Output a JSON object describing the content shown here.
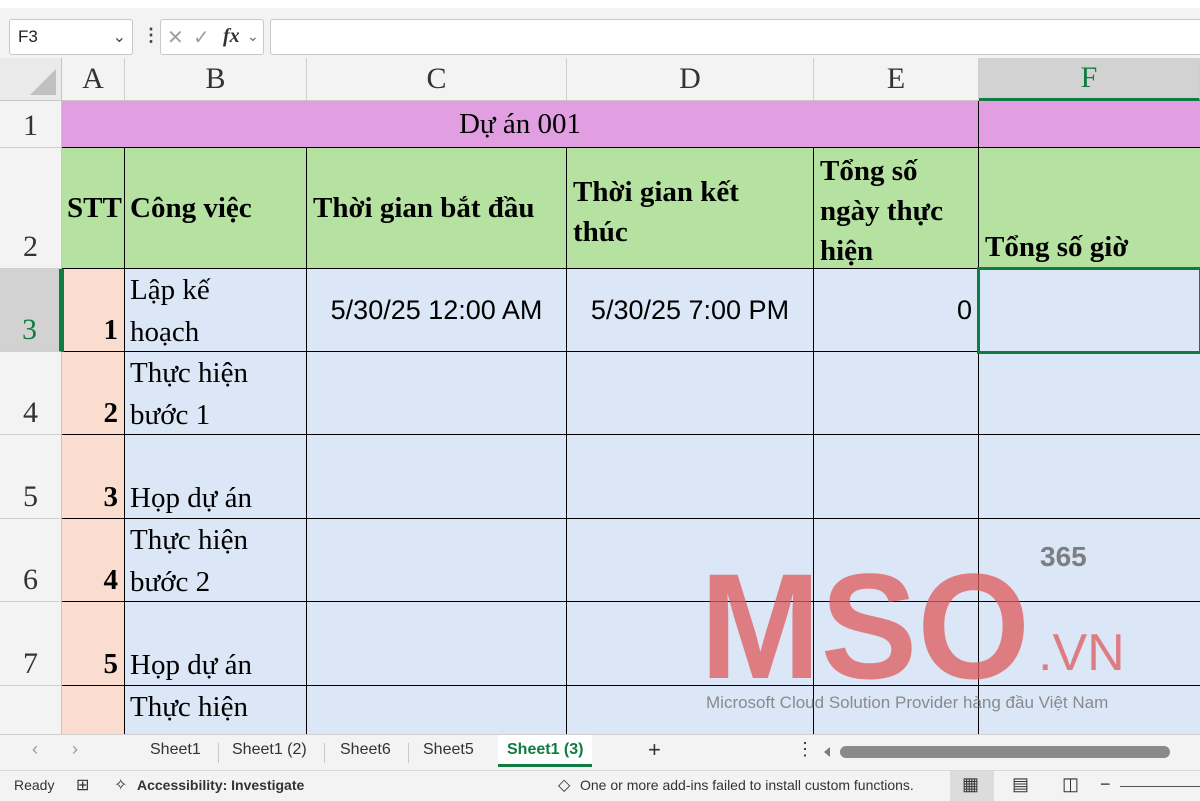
{
  "formula_bar": {
    "name_box": "F3",
    "fx_label": "fx",
    "formula": ""
  },
  "columns": [
    {
      "letter": "A"
    },
    {
      "letter": "B"
    },
    {
      "letter": "C"
    },
    {
      "letter": "D"
    },
    {
      "letter": "E"
    },
    {
      "letter": "F"
    }
  ],
  "rows": [
    "1",
    "2",
    "3",
    "4",
    "5",
    "6",
    "7"
  ],
  "sheet": {
    "title": "Dự án 001",
    "headers": {
      "stt": "STT",
      "task": "Công việc",
      "start": "Thời gian bắt đầu",
      "end_line1": "Thời gian kết",
      "end_line2": "thúc",
      "days_line1": "Tổng số",
      "days_line2": "ngày thực",
      "days_line3": "hiện",
      "hours": "Tổng số giờ"
    },
    "data_rows": [
      {
        "stt": "1",
        "task_line1": "Lập kế",
        "task_line2": "hoạch",
        "start": "5/30/25 12:00 AM",
        "end": "5/30/25 7:00 PM",
        "days": "0",
        "hours": ""
      },
      {
        "stt": "2",
        "task_line1": "Thực hiện",
        "task_line2": "bước 1",
        "start": "",
        "end": "",
        "days": "",
        "hours": ""
      },
      {
        "stt": "3",
        "task_line1": "",
        "task_line2": "Họp dự án",
        "start": "",
        "end": "",
        "days": "",
        "hours": ""
      },
      {
        "stt": "4",
        "task_line1": "Thực hiện",
        "task_line2": "bước 2",
        "start": "",
        "end": "",
        "days": "",
        "hours": ""
      },
      {
        "stt": "5",
        "task_line1": "",
        "task_line2": "Họp dự án",
        "start": "",
        "end": "",
        "days": "",
        "hours": ""
      },
      {
        "stt": "",
        "task_line1": "Thực hiện",
        "task_line2": "",
        "start": "",
        "end": "",
        "days": "",
        "hours": ""
      }
    ]
  },
  "watermark": {
    "brand": "MSO",
    "superscript": "365",
    "domain": ".VN",
    "tagline": "Microsoft Cloud Solution Provider hàng đầu Việt Nam",
    "color": "#e05a5a"
  },
  "tabs": {
    "items": [
      "Sheet1",
      "Sheet1 (2)",
      "Sheet6",
      "Sheet5",
      "Sheet1 (3)"
    ],
    "active": "Sheet1 (3)",
    "add_label": "+",
    "more_label": "⋮"
  },
  "status": {
    "ready": "Ready",
    "accessibility": "Accessibility: Investigate",
    "message": "One or more add-ins failed to install custom functions."
  },
  "colors": {
    "accent": "#107c41",
    "title_fill": "#e19ee0",
    "header_fill": "#b6e2a1",
    "stt_fill": "#fbddcf",
    "body_fill": "#dbe6f6"
  }
}
